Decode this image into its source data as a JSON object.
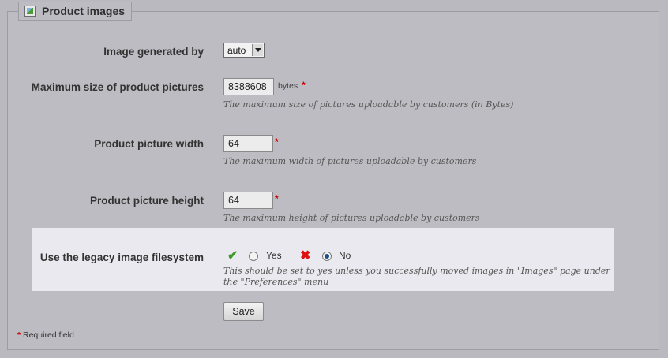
{
  "panel": {
    "title": "Product images",
    "icon": "image-icon"
  },
  "fields": {
    "image_generated_by": {
      "label": "Image generated by",
      "selected": "auto"
    },
    "max_size": {
      "label": "Maximum size of product pictures",
      "value": "8388608",
      "unit": "bytes",
      "required_mark": "*",
      "hint": "The maximum size of pictures uploadable by customers (in Bytes)"
    },
    "width": {
      "label": "Product picture width",
      "value": "64",
      "required_mark": "*",
      "hint": "The maximum width of pictures uploadable by customers"
    },
    "height": {
      "label": "Product picture height",
      "value": "64",
      "required_mark": "*",
      "hint": "The maximum height of pictures uploadable by customers"
    },
    "legacy": {
      "label": "Use the legacy image filesystem",
      "yes_label": "Yes",
      "no_label": "No",
      "selected": "No",
      "hint_line1": "This should be set to yes unless you successfully moved images in \"Images\" page under",
      "hint_line2": "the \"Preferences\" menu"
    }
  },
  "actions": {
    "save_label": "Save"
  },
  "footer": {
    "required_star": "*",
    "required_text": " Required field"
  },
  "colors": {
    "required": "#cc0000",
    "yes_icon": "#3d9a2a",
    "no_icon": "#dd1111",
    "highlight_row": "#e9e9ef"
  }
}
